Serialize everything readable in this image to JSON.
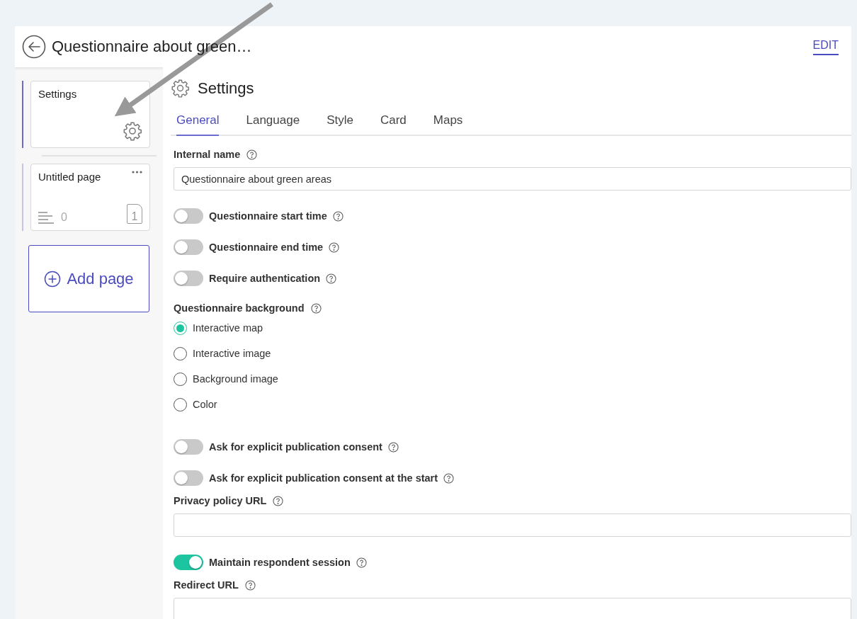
{
  "header": {
    "title": "Questionnaire about green…",
    "action": "EDIT"
  },
  "sidebar": {
    "pages": [
      {
        "kind": "settings",
        "title": "Settings",
        "selected": true
      },
      {
        "kind": "page",
        "title": "Untitled page",
        "count": "0",
        "number": "1",
        "selected": false
      }
    ],
    "add_button": "Add page"
  },
  "panel": {
    "title": "Settings",
    "tabs": [
      {
        "label": "General",
        "selected": true
      },
      {
        "label": "Language",
        "selected": false
      },
      {
        "label": "Style",
        "selected": false
      },
      {
        "label": "Card",
        "selected": false
      },
      {
        "label": "Maps",
        "selected": false
      }
    ],
    "fields": [
      {
        "kind": "text",
        "label": "Internal name",
        "value": "Questionnaire about green areas"
      },
      {
        "kind": "toggle",
        "label": "Questionnaire start time",
        "on": false
      },
      {
        "kind": "toggle",
        "label": "Questionnaire end time",
        "on": false
      },
      {
        "kind": "toggle",
        "label": "Require authentication",
        "on": false
      },
      {
        "kind": "radio",
        "label": "Questionnaire background",
        "options": [
          {
            "label": "Interactive map",
            "selected": true
          },
          {
            "label": "Interactive image",
            "selected": false
          },
          {
            "label": "Background image",
            "selected": false
          },
          {
            "label": "Color",
            "selected": false
          }
        ]
      },
      {
        "kind": "toggle",
        "label": "Ask for explicit publication consent",
        "on": false
      },
      {
        "kind": "toggle",
        "label": "Ask for explicit publication consent at the start",
        "on": false
      },
      {
        "kind": "text",
        "label": "Privacy policy URL"
      },
      {
        "kind": "toggle",
        "label": "Maintain respondent session",
        "on": true
      },
      {
        "kind": "text",
        "label": "Redirect URL"
      }
    ]
  }
}
